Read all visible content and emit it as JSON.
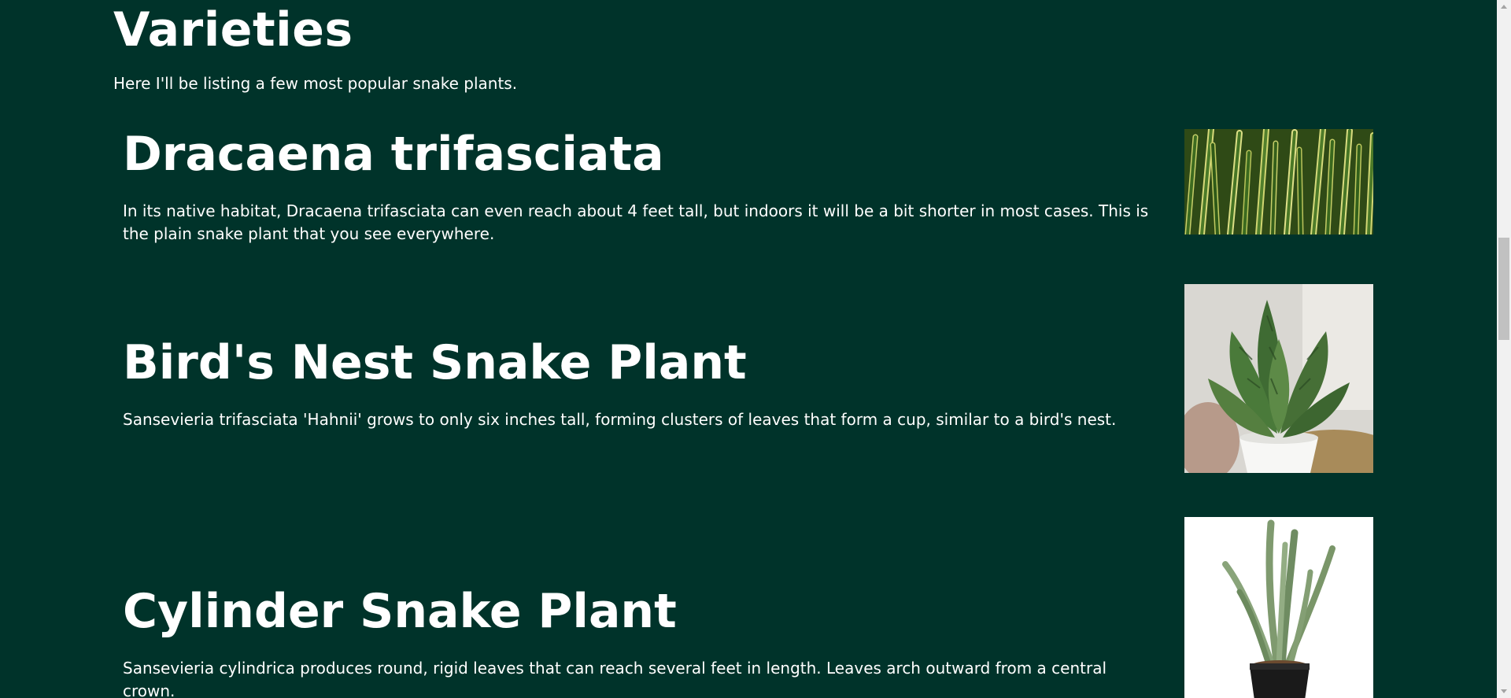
{
  "section": {
    "title": "Varieties",
    "intro": "Here I'll be listing a few most popular snake plants."
  },
  "varieties": [
    {
      "name": "Dracaena trifasciata",
      "description": "In its native habitat, Dracaena trifasciata can even reach about 4 feet tall, but indoors it will be a bit shorter in most cases. This is the plain snake plant that you see everywhere.",
      "image_icon": "striped-snake-plant-leaves-photo"
    },
    {
      "name": "Bird's Nest Snake Plant",
      "description": "Sansevieria trifasciata 'Hahnii' grows to only six inches tall, forming clusters of leaves that form a cup, similar to a bird's nest.",
      "image_icon": "birds-nest-snake-plant-pot-photo"
    },
    {
      "name": "Cylinder Snake Plant",
      "description": "Sansevieria cylindrica produces round, rigid leaves that can reach several feet in length. Leaves arch outward from a central crown.",
      "image_icon": "cylinder-snake-plant-pot-photo"
    }
  ],
  "colors": {
    "background": "#00332a",
    "text": "#ffffff"
  }
}
